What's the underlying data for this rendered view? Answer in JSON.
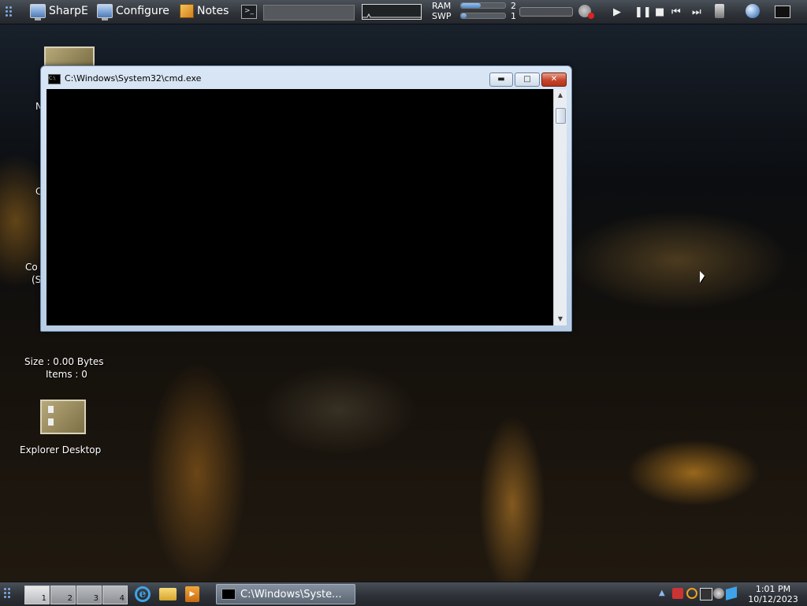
{
  "topbar": {
    "sharpe_label": "SharpE",
    "configure_label": "Configure",
    "notes_label": "Notes",
    "terminal_icon": "terminal-icon",
    "ram_label": "RAM",
    "swp_label": "SWP",
    "ram_value": "2",
    "swp_value": "1",
    "ram_fill_percent": 45,
    "swp_fill_percent": 12,
    "media_buttons": [
      "play",
      "pause",
      "stop",
      "previous",
      "next"
    ]
  },
  "desktop": {
    "size_text": "Size : 0.00 Bytes",
    "items_text": "Items : 0",
    "explorer_label": "Explorer Desktop"
  },
  "cmd_window": {
    "title": "C:\\Windows\\System32\\cmd.exe",
    "minimize_icon": "minimize-icon",
    "maximize_icon": "maximize-icon",
    "close_icon": "close-icon"
  },
  "taskbar": {
    "workspaces": [
      "1",
      "2",
      "3",
      "4"
    ],
    "active_task_label": "C:\\Windows\\Syste...",
    "clock_time": "1:01 PM",
    "clock_date": "10/12/2023"
  },
  "colors": {
    "bar_bg": "#2e3238",
    "cmd_frame": "#c9dbee",
    "close_red": "#c5442a",
    "accent_blue": "#4f86c7"
  }
}
